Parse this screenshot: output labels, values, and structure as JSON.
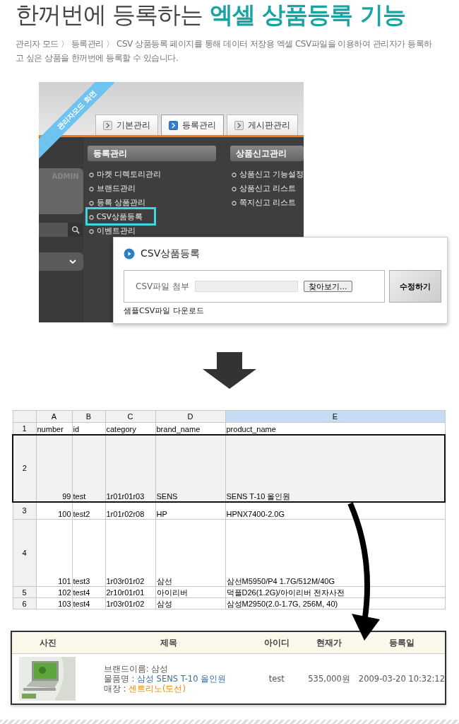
{
  "headline": {
    "text": "한꺼번에 등록하는",
    "highlight": "엑셀 상품등록 기능"
  },
  "description": "관리자 모드 〉 등록관리 〉 CSV 상품등록 페이지를 통해 데이터 저장용 엑셀 CSV파일을 이용하여 관리자가 등록하고 싶은 상품을 한꺼번에 등록할 수 있습니다.",
  "admin_screenshot": {
    "ribbon": "관리자모드 화면",
    "side_label": "ADMIN",
    "tabs": [
      {
        "label": "기본관리",
        "selected": false
      },
      {
        "label": "등록관리",
        "selected": true
      },
      {
        "label": "게시판관리",
        "selected": false
      }
    ],
    "menus": [
      {
        "title": "등록관리",
        "items": [
          {
            "label": "마켓 디렉토리관리",
            "highlighted": false
          },
          {
            "label": "브랜드관리",
            "highlighted": false
          },
          {
            "label": "등록 상품관리",
            "highlighted": false
          },
          {
            "label": "CSV상품등록",
            "highlighted": true
          },
          {
            "label": "이벤트관리",
            "highlighted": false
          }
        ]
      },
      {
        "title": "상품신고관리",
        "items": [
          {
            "label": "상품신고 기능설정",
            "highlighted": false
          },
          {
            "label": "상품신고 리스트",
            "highlighted": false
          },
          {
            "label": "쪽지신고 리스트",
            "highlighted": false
          }
        ]
      }
    ],
    "dialog": {
      "title": "CSV상품등록",
      "field_label": "CSV파일 첨부",
      "browse_button": "찾아보기...",
      "submit_button": "수정하기",
      "sample_link": "샘플CSV파일 다운로드"
    }
  },
  "spreadsheet": {
    "columns": [
      {
        "label": "A",
        "selected": false
      },
      {
        "label": "B",
        "selected": false
      },
      {
        "label": "C",
        "selected": false
      },
      {
        "label": "D",
        "selected": false
      },
      {
        "label": "E",
        "selected": true
      }
    ],
    "rows": [
      {
        "number": "1",
        "kind": "header",
        "highlighted": false,
        "cells": [
          "number",
          "id",
          "category",
          "brand_name",
          "product_name"
        ]
      },
      {
        "number": "2",
        "kind": "tall",
        "highlighted": true,
        "cells": [
          "99",
          "test",
          "1r01r01r03",
          "SENS",
          "SENS T-10 올인원"
        ]
      },
      {
        "number": "3",
        "kind": "medium",
        "highlighted": false,
        "cells": [
          "100",
          "test2",
          "1r01r02r08",
          "HP",
          "HPNX7400-2.0G"
        ]
      },
      {
        "number": "4",
        "kind": "tall",
        "highlighted": false,
        "cells": [
          "101",
          "test3",
          "1r03r01r02",
          "삼선",
          "삼선M5950/P4 1.7G/512M/40G"
        ]
      },
      {
        "number": "5",
        "kind": "short",
        "highlighted": false,
        "cells": [
          "102",
          "test4",
          "2r10r01r01",
          "아이리버",
          "덕플D26(1.2G)/아이리버 전자사전"
        ]
      },
      {
        "number": "6",
        "kind": "short",
        "highlighted": false,
        "cells": [
          "103",
          "test4",
          "1r03r01r02",
          "삼성",
          "삼성M2950(2.0-1.7G, 256M, 40)"
        ]
      }
    ]
  },
  "result_table": {
    "columns": [
      "사진",
      "제목",
      "아이디",
      "현재가",
      "등록일"
    ],
    "rows": [
      {
        "brand": "브랜드이름: 삼성",
        "product_label": "물품명 :",
        "product": "삼성 SENS T-10 올인원",
        "store_label": "매장 :",
        "store": "센트리노(도선)",
        "id": "test",
        "price": "535,000원",
        "date": "2009-03-20 10:32:12"
      }
    ]
  }
}
